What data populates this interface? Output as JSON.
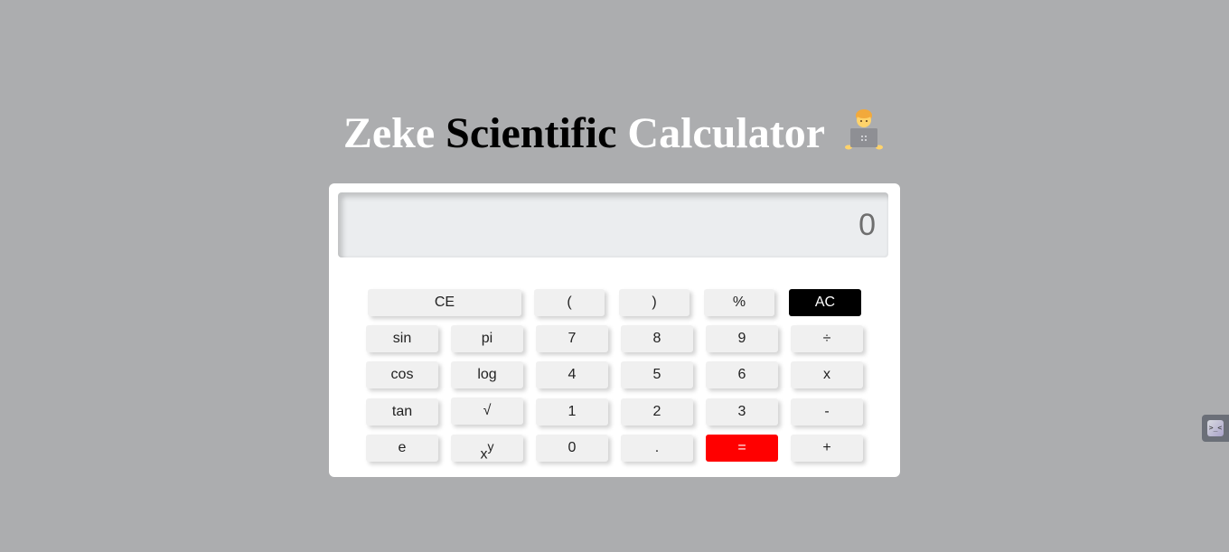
{
  "title": {
    "word1": "Zeke",
    "word2": "Scientific",
    "word3": "Calculator",
    "emoji_icon": "technologist-emoji-icon"
  },
  "display": {
    "value": "0"
  },
  "buttons": {
    "ce": "CE",
    "lparen": "(",
    "rparen": ")",
    "percent": "%",
    "ac": "AC",
    "sin": "sin",
    "pi": "pi",
    "seven": "7",
    "eight": "8",
    "nine": "9",
    "divide": "÷",
    "cos": "cos",
    "log": "log",
    "four": "4",
    "five": "5",
    "six": "6",
    "multiply": "x",
    "tan": "tan",
    "sqrt": "√",
    "one": "1",
    "two": "2",
    "three": "3",
    "minus": "-",
    "e": "e",
    "power_base": "x",
    "power_exp": "y",
    "zero": "0",
    "dot": ".",
    "equals": "=",
    "plus": "+"
  },
  "colors": {
    "background": "#acadaf",
    "ac_button": "#000000",
    "equals_button": "#ff0000",
    "button": "#f0f0f0"
  },
  "side_widget": {
    "icon": "terminal-icon",
    "glyph": ">_<"
  }
}
